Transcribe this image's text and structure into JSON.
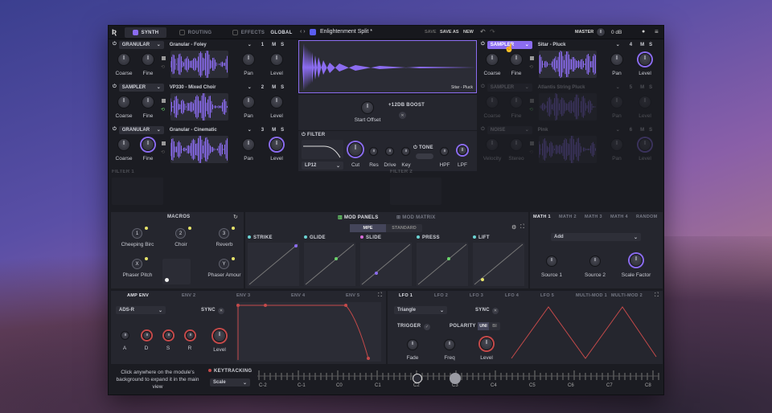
{
  "colors": {
    "accent": "#8b6cf0",
    "red": "#c64a4a",
    "yellow": "#e6e36a",
    "green": "#6bd46b"
  },
  "top": {
    "tabs": [
      "SYNTH",
      "ROUTING",
      "EFFECTS"
    ],
    "global": "GLOBAL",
    "preset": "Enlightenment Split *",
    "save": "SAVE",
    "save_as": "SAVE AS",
    "new": "NEW",
    "master": "MASTER",
    "master_value": "0 dB"
  },
  "layers": [
    {
      "type": "GRANULAR",
      "sample": "Granular - Foley",
      "num": "1",
      "m": "M",
      "s": "S",
      "coarse": "Coarse",
      "fine": "Fine",
      "pan": "Pan",
      "level": "Level"
    },
    {
      "type": "SAMPLER",
      "sample": "VP330 - Mixed Choir",
      "num": "2",
      "m": "M",
      "s": "S",
      "coarse": "Coarse",
      "fine": "Fine",
      "pan": "Pan",
      "level": "Level"
    },
    {
      "type": "GRANULAR",
      "sample": "Granular - Cinematic",
      "num": "3",
      "m": "M",
      "s": "S",
      "coarse": "Coarse",
      "fine": "Fine",
      "pan": "Pan",
      "level": "Level"
    }
  ],
  "right_layers": [
    {
      "type": "SAMPLER",
      "sample": "Sitar - Pluck",
      "num": "4",
      "m": "M",
      "s": "S",
      "coarse": "Coarse",
      "fine": "Fine",
      "pan": "Pan",
      "level": "Level"
    },
    {
      "type": "SAMPLER",
      "sample": "Atlantis String Pluck",
      "num": "5",
      "m": "M",
      "s": "S",
      "coarse": "Coarse",
      "fine": "Fine",
      "pan": "Pan",
      "level": "Level"
    },
    {
      "type": "NOISE",
      "sample": "Pink",
      "num": "6",
      "m": "M",
      "s": "S",
      "coarse": "Velocity",
      "fine": "Stereo",
      "pan": "Pan",
      "level": "Level"
    }
  ],
  "center": {
    "sample_label": "Sitar - Pluck",
    "boost": "+12DB BOOST",
    "start_offset": "Start Offset",
    "filter": "FILTER",
    "filter_type": "LP12",
    "cut": "Cut",
    "res": "Res",
    "drive": "Drive",
    "key": "Key",
    "tone": "TONE",
    "hpf": "HPF",
    "lpf": "LPF"
  },
  "filter_rows": {
    "filter1": "FILTER 1",
    "filter2": "FILTER 2"
  },
  "macros": {
    "title": "MACROS",
    "items": [
      {
        "n": "1",
        "label": "Cheeping Birc"
      },
      {
        "n": "2",
        "label": "Choir"
      },
      {
        "n": "3",
        "label": "Reverb"
      },
      {
        "n": "X",
        "label": "Phaser Pitch"
      },
      {
        "n": "Y",
        "label": "Phaser Amour"
      }
    ]
  },
  "mod": {
    "tab1": "MOD PANELS",
    "tab2": "MOD MATRIX",
    "mpe": "MPE",
    "standard": "STANDARD",
    "panels": [
      "STRIKE",
      "GLIDE",
      "SLIDE",
      "PRESS",
      "LIFT"
    ]
  },
  "math": {
    "tabs": [
      "MATH 1",
      "MATH 2",
      "MATH 3",
      "MATH 4",
      "RANDOM"
    ],
    "op": "Add",
    "k1": "Source 1",
    "k2": "Source 2",
    "k3": "Scale Factor"
  },
  "env": {
    "tabs": [
      "AMP ENV",
      "ENV 2",
      "ENV 3",
      "ENV 4",
      "ENV 5"
    ],
    "mode": "ADS-R",
    "sync": "SYNC",
    "a": "A",
    "d": "D",
    "s": "S",
    "r": "R",
    "level": "Level"
  },
  "lfo": {
    "tabs": [
      "LFO 1",
      "LFO 2",
      "LFO 3",
      "LFO 4",
      "LFO 5",
      "MULTI-MOD 1",
      "MULTI-MOD 2"
    ],
    "shape": "Triangle",
    "sync": "SYNC",
    "trigger": "TRIGGER",
    "polarity": "POLARITY",
    "uni": "UNI",
    "bi": "BI",
    "fade": "Fade",
    "freq": "Freq",
    "level": "Level"
  },
  "footer": {
    "hint": "Click anywhere on the module's background to expand it in the main view",
    "keytracking": "KEYTRACKING",
    "scale": "Scale",
    "notes": [
      "C-2",
      "C-1",
      "C0",
      "C1",
      "C2",
      "C3",
      "C4",
      "C5",
      "C6",
      "C7",
      "C8"
    ]
  }
}
